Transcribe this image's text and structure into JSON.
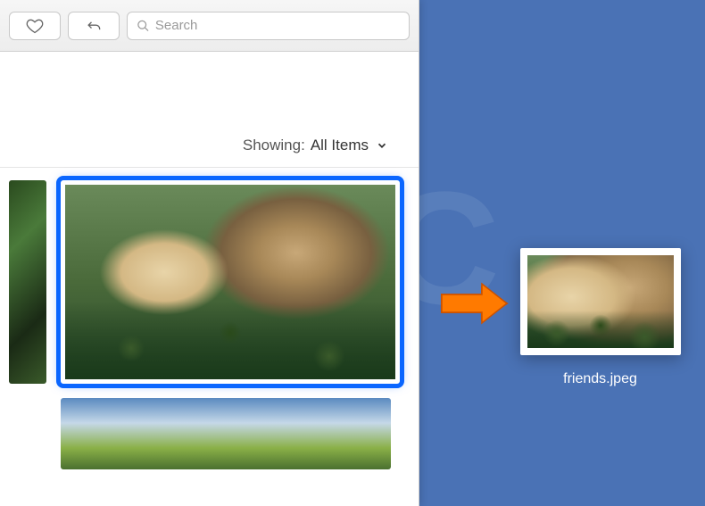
{
  "toolbar": {
    "icons": {
      "heart": "heart-icon",
      "share": "share-icon"
    }
  },
  "search": {
    "placeholder": "Search",
    "value": ""
  },
  "filter": {
    "label": "Showing:",
    "value": "All Items"
  },
  "thumbnails": [
    {
      "name": "nature-partial",
      "selected": false
    },
    {
      "name": "friends-pets",
      "selected": true
    },
    {
      "name": "landscape-partial",
      "selected": false
    }
  ],
  "desktop": {
    "filename": "friends.jpeg"
  }
}
